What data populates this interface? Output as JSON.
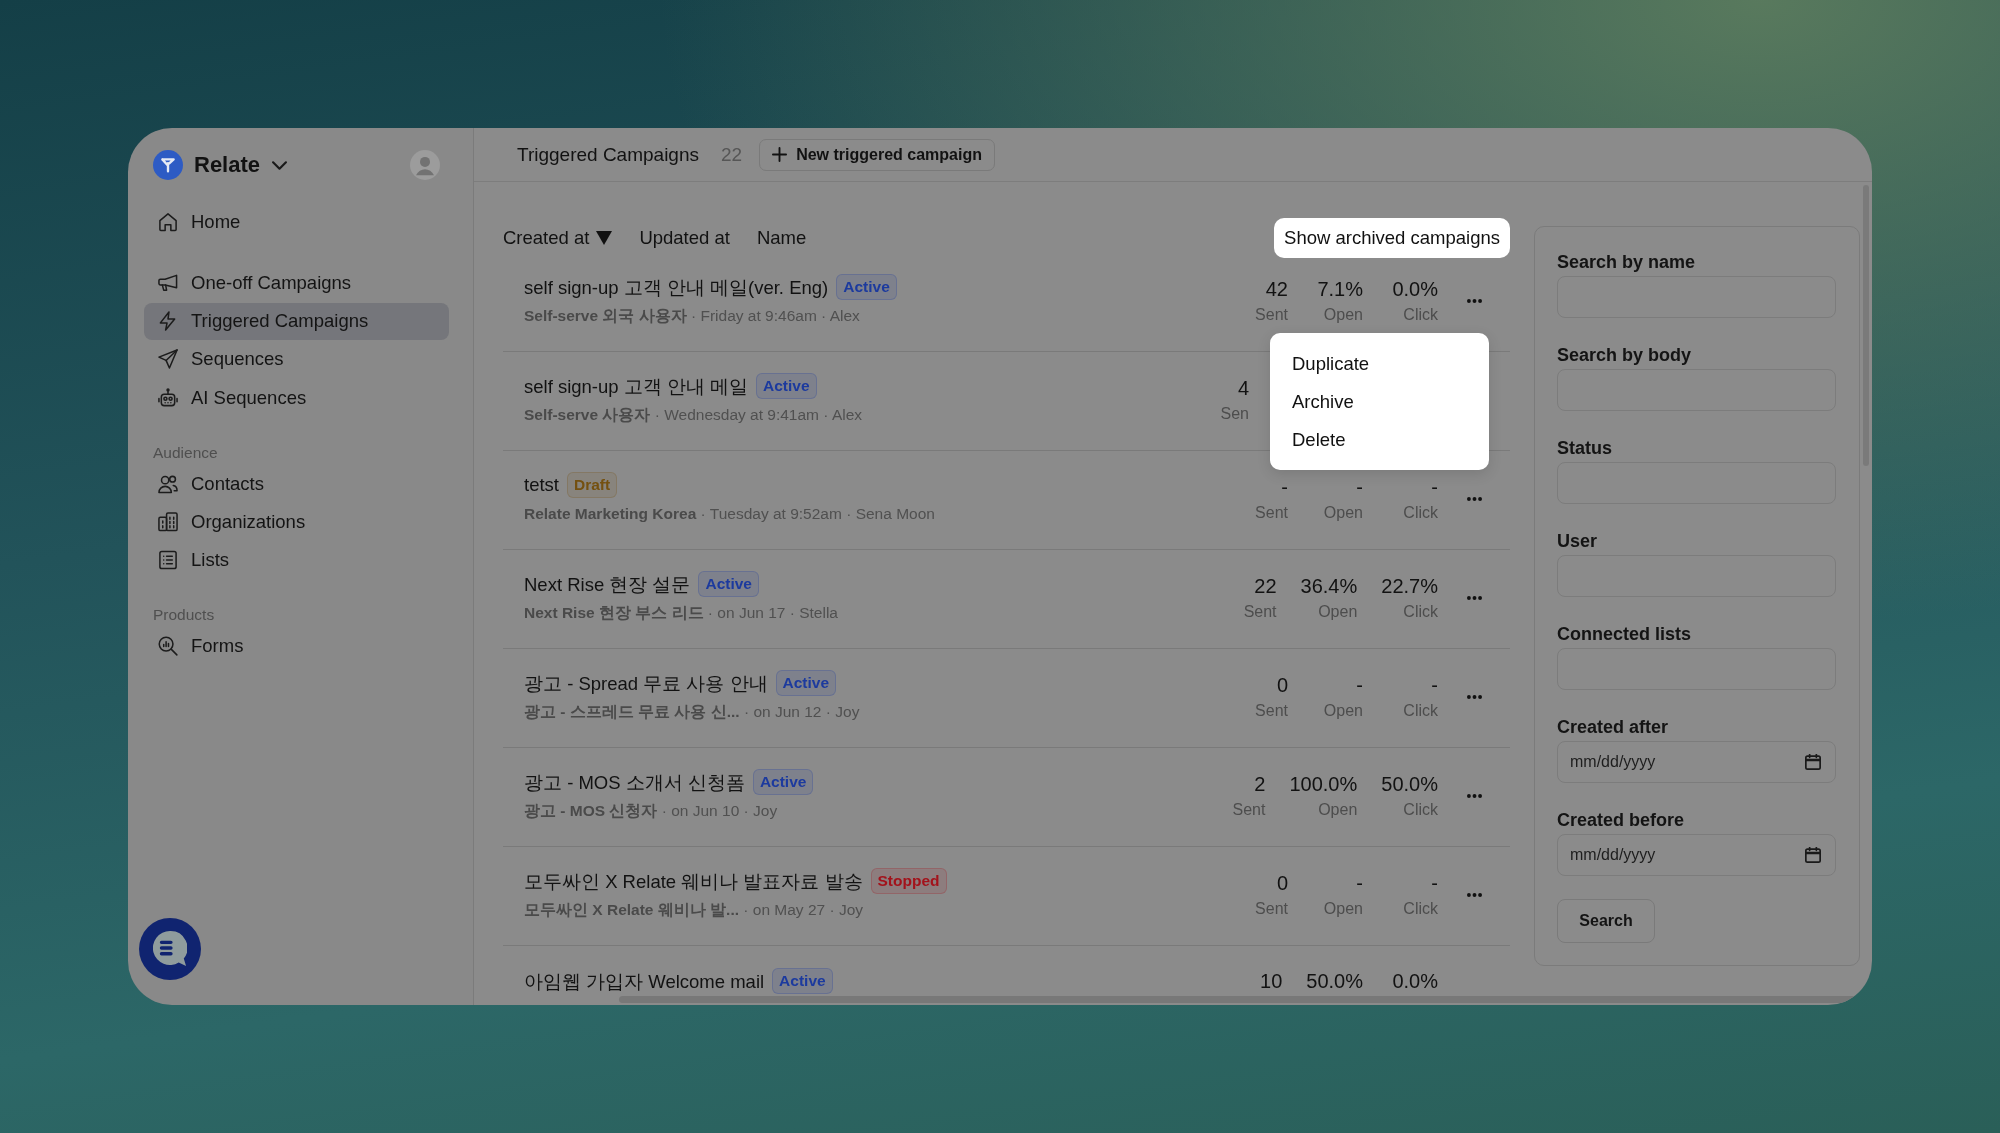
{
  "sidebar": {
    "workspace": "Relate",
    "sections": [
      {
        "items": [
          {
            "label": "Home",
            "kind": "home",
            "selected": false
          }
        ]
      },
      {
        "items": [
          {
            "label": "One-off Campaigns",
            "kind": "megaphone",
            "selected": false
          },
          {
            "label": "Triggered Campaigns",
            "kind": "bolt",
            "selected": true
          },
          {
            "label": "Sequences",
            "kind": "plane",
            "selected": false
          },
          {
            "label": "AI Sequences",
            "kind": "robot",
            "selected": false
          }
        ]
      },
      {
        "heading": "Audience",
        "items": [
          {
            "label": "Contacts",
            "kind": "users",
            "selected": false
          },
          {
            "label": "Organizations",
            "kind": "building",
            "selected": false
          },
          {
            "label": "Lists",
            "kind": "list",
            "selected": false
          }
        ]
      },
      {
        "heading": "Products",
        "items": [
          {
            "label": "Forms",
            "kind": "search",
            "selected": false
          }
        ]
      }
    ]
  },
  "header": {
    "title": "Triggered Campaigns",
    "count": "22",
    "new_button": "New triggered campaign"
  },
  "sort": {
    "options": [
      {
        "label": "Created at",
        "selected": true
      },
      {
        "label": "Updated at",
        "selected": false
      },
      {
        "label": "Name",
        "selected": false
      }
    ],
    "archived_button": "Show archived campaigns"
  },
  "rows": [
    {
      "title": "self sign-up 고객 안내 메일(ver. Eng)",
      "badge": {
        "label": "Active",
        "color": "#1c3a9e"
      },
      "meta": "**Self-serve 외국 사용자** · Friday at 9:46am · Alex",
      "stats": [
        {
          "value": "42",
          "label": "Sent"
        },
        {
          "value": "7.1%",
          "label": "Open"
        },
        {
          "value": "0.0%",
          "label": "Click"
        }
      ],
      "more_button": true,
      "covered": false,
      "menu": {
        "items": [
          "Duplicate",
          "Archive",
          "Delete"
        ]
      }
    },
    {
      "title": "self sign-up 고객 안내 메일",
      "badge": {
        "label": "Active",
        "color": "#1c3a9e"
      },
      "meta": "**Self-serve 사용자** · Wednesday at 9:41am · Alex",
      "stats": [
        {
          "value": "4",
          "label": "Sen"
        }
      ],
      "more_button": false,
      "covered": true
    },
    {
      "title": "tetst",
      "badge": {
        "label": "Draft",
        "color": "#74500f"
      },
      "meta": "**Relate Marketing Korea** · Tuesday at 9:52am · Sena Moon",
      "stats": [
        {
          "value": "-",
          "label": "Sent"
        },
        {
          "value": "-",
          "label": "Open"
        },
        {
          "value": "-",
          "label": "Click"
        }
      ],
      "more_button": true,
      "covered": false
    },
    {
      "title": "Next Rise 현장 설문",
      "badge": {
        "label": "Active",
        "color": "#1c3a9e"
      },
      "meta": "**Next Rise 현장 부스 리드** · on Jun 17 · Stella",
      "stats": [
        {
          "value": "22",
          "label": "Sent"
        },
        {
          "value": "36.4%",
          "label": "Open"
        },
        {
          "value": "22.7%",
          "label": "Click"
        }
      ],
      "more_button": true,
      "covered": false
    },
    {
      "title": "광고 - Spread 무료 사용 안내",
      "badge": {
        "label": "Active",
        "color": "#1c3a9e"
      },
      "meta": "**광고 - 스프레드 무료 사용 신...** · on Jun 12 · Joy",
      "stats": [
        {
          "value": "0",
          "label": "Sent"
        },
        {
          "value": "-",
          "label": "Open"
        },
        {
          "value": "-",
          "label": "Click"
        }
      ],
      "more_button": true,
      "covered": false
    },
    {
      "title": "광고 - MOS 소개서 신청폼",
      "badge": {
        "label": "Active",
        "color": "#1c3a9e"
      },
      "meta": "**광고 - MOS 신청자** · on Jun 10 · Joy",
      "stats": [
        {
          "value": "2",
          "label": "Sent"
        },
        {
          "value": "100.0%",
          "label": "Open"
        },
        {
          "value": "50.0%",
          "label": "Click"
        }
      ],
      "more_button": true,
      "covered": false
    },
    {
      "title": "모두싸인 X Relate 웨비나 발표자료 발송",
      "badge": {
        "label": "Stopped",
        "color": "#a3121b"
      },
      "meta": "**모두싸인 X Relate 웨비나 발...** · on May 27 · Joy",
      "stats": [
        {
          "value": "0",
          "label": "Sent"
        },
        {
          "value": "-",
          "label": "Open"
        },
        {
          "value": "-",
          "label": "Click"
        }
      ],
      "more_button": true,
      "covered": false
    },
    {
      "title": "아임웹 가입자 Welcome mail",
      "badge": {
        "label": "Active",
        "color": "#1c3a9e"
      },
      "stats": [
        {
          "value": "10"
        },
        {
          "value": "50.0%"
        },
        {
          "value": "0.0%"
        }
      ],
      "more_button": false,
      "covered": false
    }
  ],
  "filters": {
    "fields": [
      {
        "label": "Search by name",
        "kind": "text"
      },
      {
        "label": "Search by body",
        "kind": "text"
      },
      {
        "label": "Status",
        "kind": "text"
      },
      {
        "label": "User",
        "kind": "text"
      },
      {
        "label": "Connected lists",
        "kind": "text"
      },
      {
        "label": "Created after",
        "kind": "date",
        "placeholder": "mm/dd/yyyy"
      },
      {
        "label": "Created before",
        "kind": "date",
        "placeholder": "mm/dd/yyyy"
      }
    ],
    "button": "Search"
  }
}
